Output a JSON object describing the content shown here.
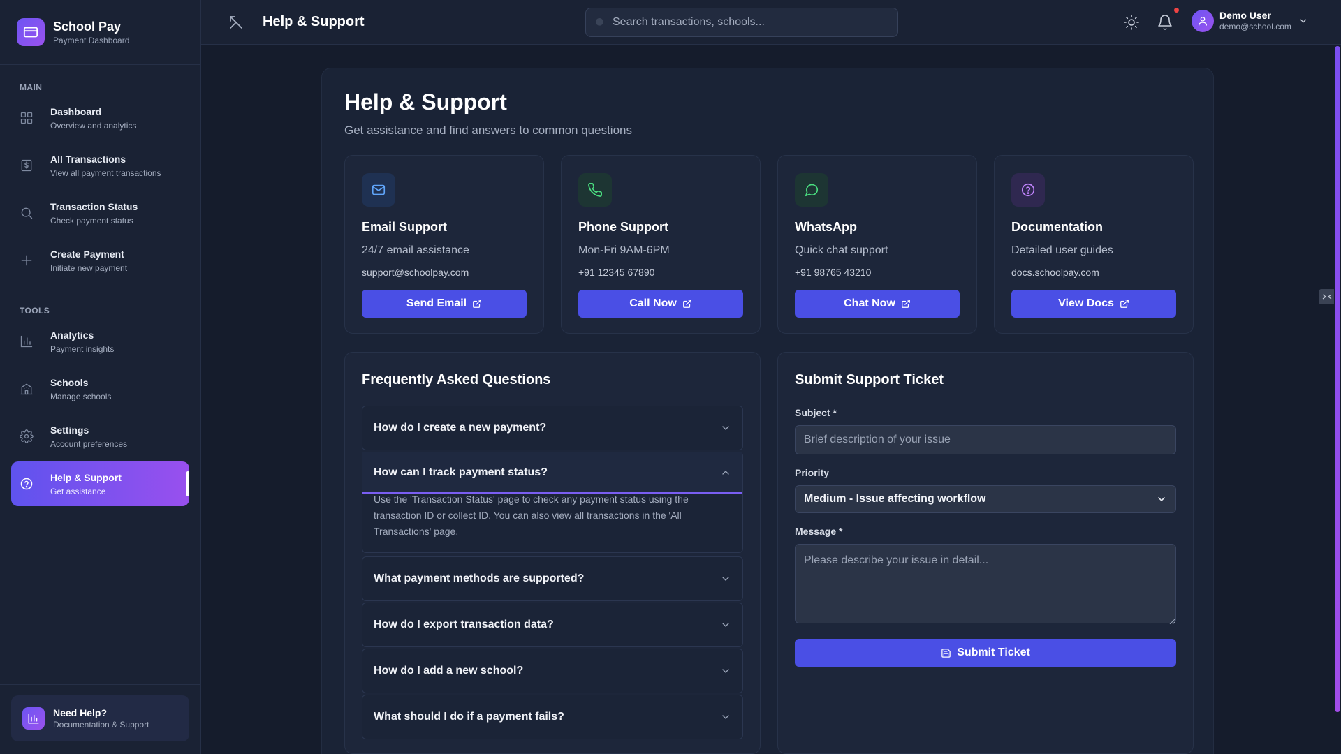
{
  "brand": {
    "name": "School Pay",
    "subtitle": "Payment Dashboard"
  },
  "sidebar": {
    "sections": [
      "MAIN",
      "TOOLS"
    ],
    "main_items": [
      {
        "label": "Dashboard",
        "sub": "Overview and analytics",
        "icon": "grid-icon"
      },
      {
        "label": "All Transactions",
        "sub": "View all payment transactions",
        "icon": "receipt-icon"
      },
      {
        "label": "Transaction Status",
        "sub": "Check payment status",
        "icon": "search-icon"
      },
      {
        "label": "Create Payment",
        "sub": "Initiate new payment",
        "icon": "plus-icon"
      }
    ],
    "tool_items": [
      {
        "label": "Analytics",
        "sub": "Payment insights",
        "icon": "bar-chart-icon"
      },
      {
        "label": "Schools",
        "sub": "Manage schools",
        "icon": "building-icon"
      },
      {
        "label": "Settings",
        "sub": "Account preferences",
        "icon": "gear-icon"
      },
      {
        "label": "Help & Support",
        "sub": "Get assistance",
        "icon": "help-circle-icon",
        "active": true
      }
    ],
    "need_help": {
      "title": "Need Help?",
      "sub": "Documentation & Support"
    }
  },
  "topbar": {
    "title": "Help & Support",
    "search_placeholder": "Search transactions, schools...",
    "user": {
      "name": "Demo User",
      "email": "demo@school.com"
    }
  },
  "main": {
    "title": "Help & Support",
    "subtitle": "Get assistance and find answers to common questions",
    "cards": [
      {
        "title": "Email Support",
        "desc": "24/7 email assistance",
        "contact": "support@schoolpay.com",
        "button": "Send Email",
        "icon": "mail-icon",
        "color": "#60a5fa"
      },
      {
        "title": "Phone Support",
        "desc": "Mon-Fri 9AM-6PM",
        "contact": "+91 12345 67890",
        "button": "Call Now",
        "icon": "phone-icon",
        "color": "#4ade80"
      },
      {
        "title": "WhatsApp",
        "desc": "Quick chat support",
        "contact": "+91 98765 43210",
        "button": "Chat Now",
        "icon": "chat-icon",
        "color": "#4ade80"
      },
      {
        "title": "Documentation",
        "desc": "Detailed user guides",
        "contact": "docs.schoolpay.com",
        "button": "View Docs",
        "icon": "help-circle-icon",
        "color": "#c084fc"
      }
    ],
    "faq": {
      "title": "Frequently Asked Questions",
      "items": [
        {
          "q": "How do I create a new payment?"
        },
        {
          "q": "How can I track payment status?",
          "a": "Use the 'Transaction Status' page to check any payment status using the transaction ID or collect ID. You can also view all transactions in the 'All Transactions' page.",
          "open": true
        },
        {
          "q": "What payment methods are supported?"
        },
        {
          "q": "How do I export transaction data?"
        },
        {
          "q": "How do I add a new school?"
        },
        {
          "q": "What should I do if a payment fails?"
        }
      ]
    },
    "ticket": {
      "title": "Submit Support Ticket",
      "subject_label": "Subject *",
      "subject_placeholder": "Brief description of your issue",
      "priority_label": "Priority",
      "priority_value": "Medium - Issue affecting workflow",
      "message_label": "Message *",
      "message_placeholder": "Please describe your issue in detail...",
      "submit_label": "Submit Ticket"
    }
  },
  "colors": {
    "accent": "#4a4fe5",
    "gradient_start": "#5f53ee",
    "gradient_end": "#9950ee",
    "notification": "#ef4444"
  }
}
